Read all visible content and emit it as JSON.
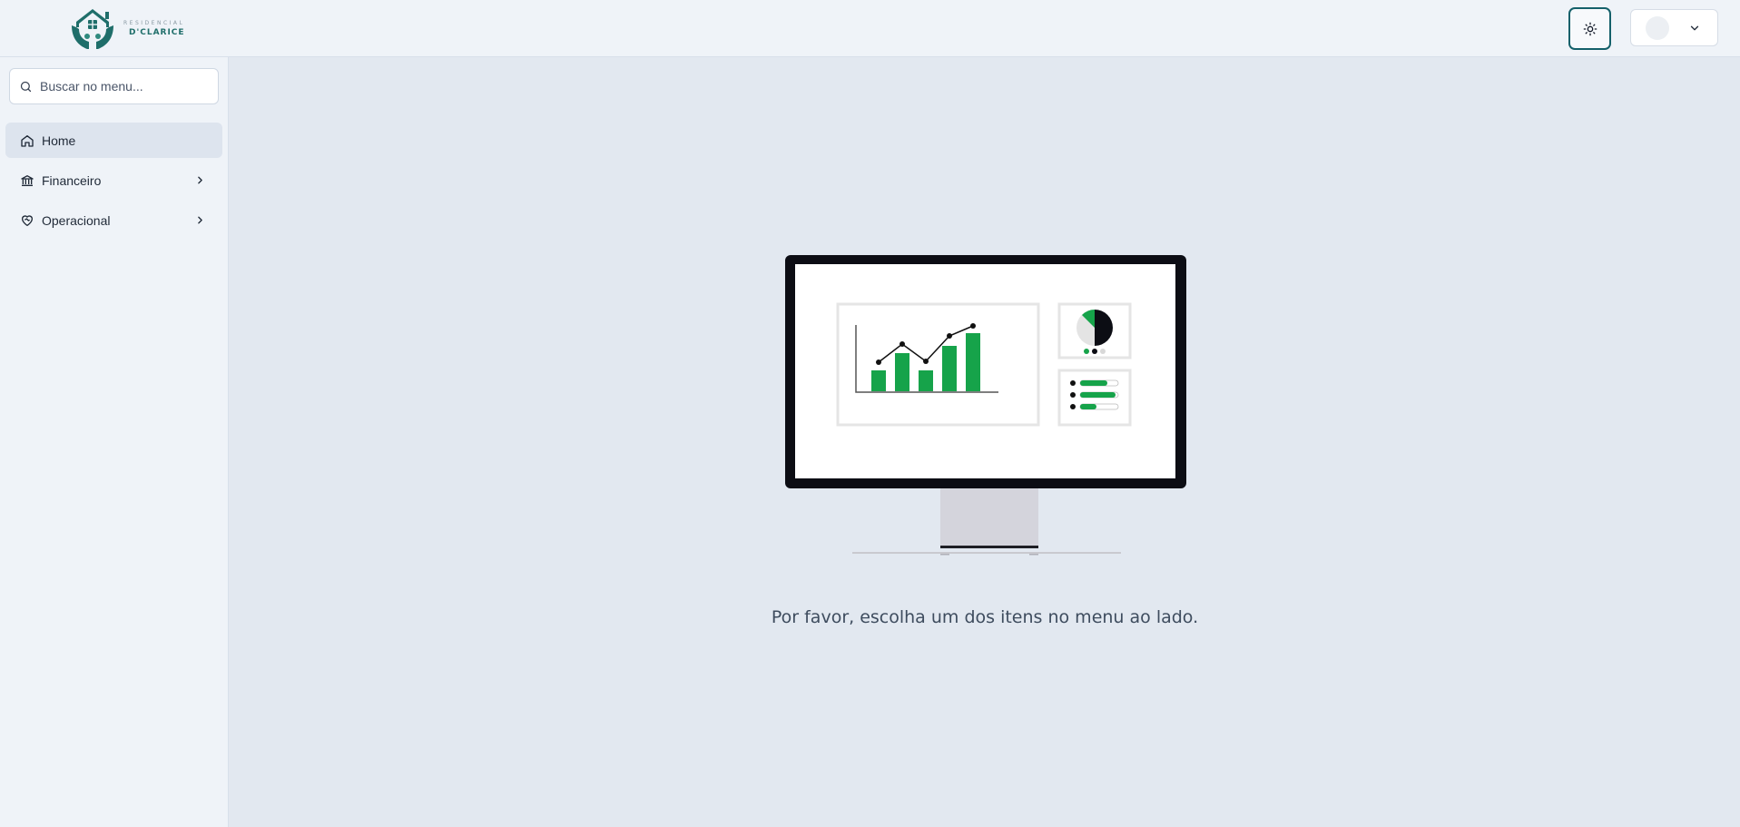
{
  "brand": {
    "subtitle": "RESIDENCIAL",
    "name": "D'CLARICE",
    "color": "#1f6e6a"
  },
  "header": {
    "theme_icon": "sun-icon",
    "user_menu_icon": "chevron-down-icon"
  },
  "search": {
    "placeholder": "Buscar no menu...",
    "value": ""
  },
  "sidebar": {
    "items": [
      {
        "label": "Home",
        "icon": "home-icon",
        "active": true
      },
      {
        "label": "Financeiro",
        "icon": "bank-icon",
        "expandable": true
      },
      {
        "label": "Operacional",
        "icon": "heart-handshake-icon",
        "expandable": true
      }
    ]
  },
  "main": {
    "message": "Por favor, escolha um dos itens no menu ao lado."
  },
  "colors": {
    "accent": "#14606a",
    "illustration_green": "#16a34a",
    "background": "#e2e8f0"
  }
}
